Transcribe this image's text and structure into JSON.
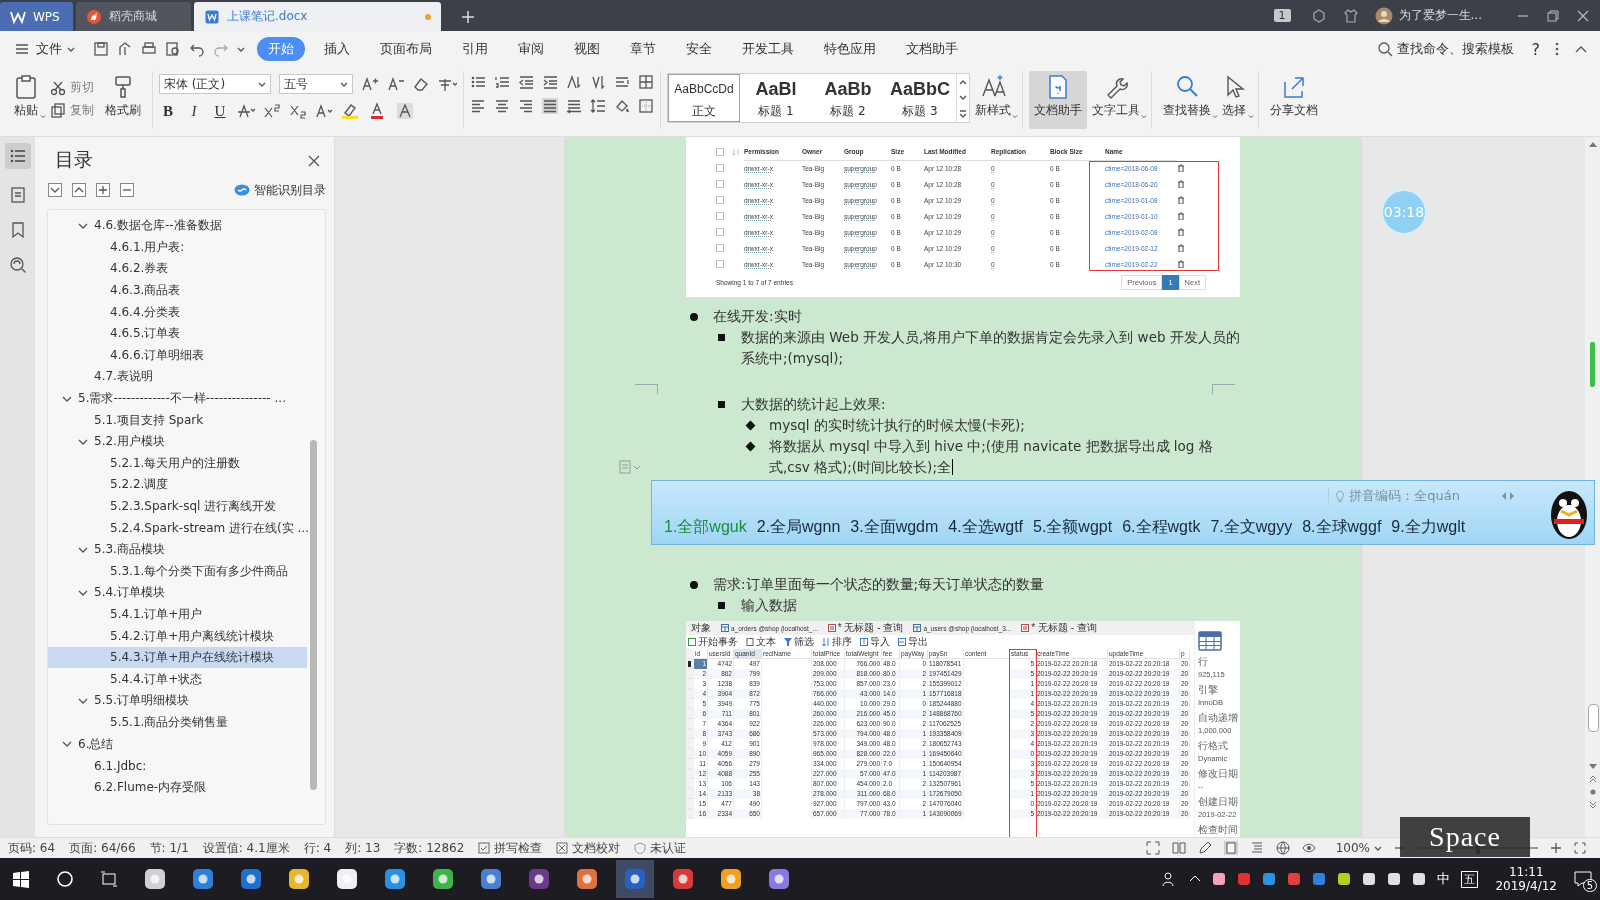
{
  "title_bar": {
    "tabs": [
      {
        "label": "WPS",
        "kind": "app",
        "selected": false,
        "modified": false
      },
      {
        "label": "稻壳商城",
        "kind": "store",
        "selected": false,
        "modified": false
      },
      {
        "label": "上课笔记.docx",
        "kind": "doc",
        "selected": true,
        "modified": true
      }
    ],
    "window_count": "1",
    "user": "为了爱梦一生..."
  },
  "menu_bar": {
    "file": "文件",
    "tabs": [
      {
        "label": "开始",
        "selected": true
      },
      {
        "label": "插入",
        "selected": false
      },
      {
        "label": "页面布局",
        "selected": false
      },
      {
        "label": "引用",
        "selected": false
      },
      {
        "label": "审阅",
        "selected": false
      },
      {
        "label": "视图",
        "selected": false
      },
      {
        "label": "章节",
        "selected": false
      },
      {
        "label": "安全",
        "selected": false
      },
      {
        "label": "开发工具",
        "selected": false
      },
      {
        "label": "特色应用",
        "selected": false
      },
      {
        "label": "文档助手",
        "selected": false
      }
    ],
    "search": "查找命令、搜索模板",
    "help": "?"
  },
  "ribbon": {
    "paste": "粘贴",
    "clipboard": [
      {
        "label": "剪切",
        "kind": "cut",
        "disabled": true
      },
      {
        "label": "复制",
        "kind": "copy",
        "disabled": true
      }
    ],
    "format_painter": "格式刷",
    "font": "宋体 (正文)",
    "size": "五号",
    "format_buttons": [
      {
        "label": "B",
        "kind": "bold"
      },
      {
        "label": "I",
        "kind": "italic"
      },
      {
        "label": "U",
        "kind": "underline"
      }
    ],
    "styles": [
      {
        "preview": "AaBbCcDd",
        "label": "正文",
        "kind": "body",
        "selected": true
      },
      {
        "preview": "AaBl",
        "label": "标题 1",
        "kind": "heading",
        "selected": false
      },
      {
        "preview": "AaBb",
        "label": "标题 2",
        "kind": "heading",
        "selected": false
      },
      {
        "preview": "AaBbC",
        "label": "标题 3",
        "kind": "heading",
        "selected": false
      }
    ],
    "new_style": "新样式",
    "tools": [
      {
        "label": "文档助手",
        "kind": "assistant",
        "selected": true,
        "dropdown": false
      },
      {
        "label": "文字工具",
        "kind": "wrench",
        "selected": false,
        "dropdown": true
      },
      {
        "label": "查找替换",
        "kind": "find",
        "selected": false,
        "dropdown": true
      },
      {
        "label": "选择",
        "kind": "pointer",
        "selected": false,
        "dropdown": true
      },
      {
        "label": "分享文档",
        "kind": "share",
        "selected": false,
        "dropdown": false
      }
    ]
  },
  "toc": {
    "title": "目录",
    "smart_button": "智能识别目录",
    "continued_items": [
      {
        "label": "4.6.数据仓库--准备数据",
        "selected": false,
        "expanded": true,
        "children": [
          {
            "label": "4.6.1.用户表:",
            "selected": false
          },
          {
            "label": "4.6.2.券表",
            "selected": false
          },
          {
            "label": "4.6.3.商品表",
            "selected": false
          },
          {
            "label": "4.6.4.分类表",
            "selected": false
          },
          {
            "label": "4.6.5.订单表",
            "selected": false
          },
          {
            "label": "4.6.6.订单明细表",
            "selected": false
          }
        ]
      },
      {
        "label": "4.7.表说明",
        "selected": false
      }
    ],
    "items": [
      {
        "label": "5.需求-------------不一样--------------- ...",
        "selected": false,
        "expanded": true,
        "children": [
          {
            "label": "5.1.项目支持 Spark",
            "selected": false
          },
          {
            "label": "5.2.用户模块",
            "selected": false,
            "expanded": true,
            "children": [
              {
                "label": "5.2.1.每天用户的注册数",
                "selected": false
              },
              {
                "label": "5.2.2.调度",
                "selected": false
              },
              {
                "label": "5.2.3.Spark-sql 进行离线开发",
                "selected": false
              },
              {
                "label": "5.2.4.Spark-stream 进行在线(实 ...",
                "selected": false
              }
            ]
          },
          {
            "label": "5.3.商品模块",
            "selected": false,
            "expanded": true,
            "children": [
              {
                "label": "5.3.1.每个分类下面有多少件商品",
                "selected": false
              }
            ]
          },
          {
            "label": "5.4.订单模块",
            "selected": false,
            "expanded": true,
            "children": [
              {
                "label": "5.4.1.订单+用户",
                "selected": false
              },
              {
                "label": "5.4.2.订单+用户离线统计模块",
                "selected": false
              },
              {
                "label": "5.4.3.订单+用户在线统计模块",
                "selected": true
              },
              {
                "label": "5.4.4.订单+状态",
                "selected": false
              }
            ]
          },
          {
            "label": "5.5.订单明细模块",
            "selected": false,
            "expanded": true,
            "children": [
              {
                "label": "5.5.1.商品分类销售量",
                "selected": false
              }
            ]
          }
        ]
      },
      {
        "label": "6.总结",
        "selected": false,
        "expanded": true,
        "children": [
          {
            "label": "6.1.Jdbc:",
            "selected": false
          },
          {
            "label": "6.2.Flume-内存受限",
            "selected": false
          }
        ]
      }
    ]
  },
  "document": {
    "blocks": [
      {
        "kind": "hdfs_table",
        "columns": [
          "Permission",
          "Owner",
          "Group",
          "Size",
          "Last Modified",
          "Replication",
          "Block Size",
          "Name"
        ],
        "rows": [
          [
            "drwxr-xr-x",
            "Tea-Big",
            "supergroup",
            "0 B",
            "Apr 12 10:28",
            "0",
            "0 B",
            "ctime=2018-06-08"
          ],
          [
            "drwxr-xr-x",
            "Tea-Big",
            "supergroup",
            "0 B",
            "Apr 12 10:28",
            "0",
            "0 B",
            "ctime=2018-06-20"
          ],
          [
            "drwxr-xr-x",
            "Tea-Big",
            "supergroup",
            "0 B",
            "Apr 12 10:29",
            "0",
            "0 B",
            "ctime=2019-01-08"
          ],
          [
            "drwxr-xr-x",
            "Tea-Big",
            "supergroup",
            "0 B",
            "Apr 12 10:29",
            "0",
            "0 B",
            "ctime=2019-01-10"
          ],
          [
            "drwxr-xr-x",
            "Tea-Big",
            "supergroup",
            "0 B",
            "Apr 12 10:29",
            "0",
            "0 B",
            "ctime=2019-02-08"
          ],
          [
            "drwxr-xr-x",
            "Tea-Big",
            "supergroup",
            "0 B",
            "Apr 12 10:29",
            "0",
            "0 B",
            "ctime=2019-02-12"
          ],
          [
            "drwxr-xr-x",
            "Tea-Big",
            "supergroup",
            "0 B",
            "Apr 12 10:30",
            "0",
            "0 B",
            "ctime=2019-02-22"
          ]
        ],
        "footer": "Showing 1 to 7 of 7 entries",
        "pages": [
          {
            "label": "Previous",
            "selected": false
          },
          {
            "label": "1",
            "selected": true
          },
          {
            "label": "Next",
            "selected": false
          }
        ]
      },
      {
        "kind": "list",
        "items": [
          {
            "kind": "item",
            "text": "在线开发:实时",
            "children": [
              {
                "kind": "item",
                "text": "数据的来源由 Web 开发人员,将用户下单的数据肯定会先录入到 web 开发人员的系统中;(mysql);"
              },
              {
                "kind": "page_break"
              },
              {
                "kind": "item",
                "text": "大数据的统计起上效果:",
                "children": [
                  {
                    "kind": "item",
                    "text": "mysql 的实时统计执行的时候太慢(卡死);"
                  },
                  {
                    "kind": "item",
                    "text": "将数据从 mysql 中导入到 hive 中;(使用 navicate 把数据导出成 log 格式,csv 格式);(时间比较长);全",
                    "cursor": true
                  }
                ]
              }
            ]
          }
        ]
      },
      {
        "kind": "list",
        "items": [
          {
            "kind": "item",
            "text": "需求:订单里面每一个状态的数量;每天订单状态的数量",
            "children": [
              {
                "kind": "item",
                "text": "输入数据"
              }
            ]
          }
        ]
      },
      {
        "kind": "db_table",
        "tabs": [
          {
            "label": "对象",
            "kind": "plain"
          },
          {
            "label": "a_orders @shop (localhost_...",
            "kind": "table"
          },
          {
            "label": "* 无标题 - 查询",
            "kind": "query"
          },
          {
            "label": "a_users @shop (localhost_3...",
            "kind": "table"
          },
          {
            "label": "* 无标题 - 查询",
            "kind": "query"
          }
        ],
        "toolbar": [
          {
            "label": "开始事务",
            "kind": "transaction"
          },
          {
            "label": "文本",
            "kind": "text"
          },
          {
            "label": "筛选",
            "kind": "filter"
          },
          {
            "label": "排序",
            "kind": "sort"
          },
          {
            "label": "导入",
            "kind": "import"
          },
          {
            "label": "导出",
            "kind": "export"
          }
        ],
        "columns": [
          {
            "label": "id",
            "kind": "num",
            "sorted": false
          },
          {
            "label": "usersId",
            "kind": "num",
            "sorted": false
          },
          {
            "label": "quanId",
            "kind": "num",
            "sorted": true
          },
          {
            "label": "reciName",
            "sorted": false
          },
          {
            "label": "totalPrice",
            "kind": "text",
            "sorted": false
          },
          {
            "label": "totalWeight",
            "kind": "num",
            "sorted": false
          },
          {
            "label": "fee",
            "kind": "text",
            "sorted": false
          },
          {
            "label": "payWay",
            "kind": "num",
            "sorted": false
          },
          {
            "label": "paySn",
            "kind": "text",
            "sorted": false
          },
          {
            "label": "content",
            "sorted": false
          },
          {
            "label": "status",
            "kind": "num",
            "sorted": false
          },
          {
            "label": "createTime",
            "kind": "text",
            "sorted": false
          },
          {
            "label": "updateTime",
            "kind": "text",
            "sorted": false
          },
          {
            "label": "p",
            "kind": "text",
            "sorted": false
          }
        ],
        "rows": [
          {
            "selected": true,
            "cells": [
              "1",
              "4742",
              "497",
              "",
              "208.000",
              "766.000",
              "48.0",
              "0",
              "118078541",
              "",
              "5",
              "2019-02-22 20:20:18",
              "2019-02-22 20:20:18",
              "20"
            ]
          },
          {
            "selected": false,
            "cells": [
              "2",
              "862",
              "799",
              "",
              "209.000",
              "818.000",
              "80.0",
              "2",
              "197451429",
              "",
              "5",
              "2019-02-22 20:20:19",
              "2019-02-22 20:20:19",
              "20"
            ]
          },
          {
            "selected": false,
            "cells": [
              "3",
              "1238",
              "839",
              "",
              "753.000",
              "857.000",
              "23.0",
              "2",
              "155399012",
              "",
              "1",
              "2019-02-22 20:20:19",
              "2019-02-22 20:20:19",
              "20"
            ]
          },
          {
            "selected": false,
            "cells": [
              "4",
              "3904",
              "872",
              "",
              "766.000",
              "43.000",
              "14.0",
              "1",
              "157716818",
              "",
              "1",
              "2019-02-22 20:20:19",
              "2019-02-22 20:20:19",
              "20"
            ]
          },
          {
            "selected": false,
            "cells": [
              "5",
              "3949",
              "775",
              "",
              "440.000",
              "10.000",
              "29.0",
              "0",
              "185244880",
              "",
              "4",
              "2019-02-22 20:20:19",
              "2019-02-22 20:20:19",
              "20"
            ]
          },
          {
            "selected": false,
            "cells": [
              "6",
              "711",
              "801",
              "",
              "260.000",
              "216.000",
              "45.0",
              "2",
              "148868760",
              "",
              "5",
              "2019-02-22 20:20:19",
              "2019-02-22 20:20:19",
              "20"
            ]
          },
          {
            "selected": false,
            "cells": [
              "7",
              "4364",
              "922",
              "",
              "226.000",
              "623.000",
              "90.0",
              "2",
              "117062525",
              "",
              "2",
              "2019-02-22 20:20:19",
              "2019-02-22 20:20:19",
              "20"
            ]
          },
          {
            "selected": false,
            "cells": [
              "8",
              "3743",
              "686",
              "",
              "573.000",
              "794.000",
              "48.0",
              "1",
              "193358409",
              "",
              "3",
              "2019-02-22 20:20:19",
              "2019-02-22 20:20:19",
              "20"
            ]
          },
          {
            "selected": false,
            "cells": [
              "9",
              "412",
              "901",
              "",
              "978.000",
              "349.000",
              "48.0",
              "2",
              "180652743",
              "",
              "4",
              "2019-02-22 20:20:19",
              "2019-02-22 20:20:19",
              "20"
            ]
          },
          {
            "selected": false,
            "cells": [
              "10",
              "4059",
              "890",
              "",
              "965.000",
              "828.000",
              "22.0",
              "1",
              "169450640",
              "",
              "0",
              "2019-02-22 20:20:19",
              "2019-02-22 20:20:19",
              "20"
            ]
          },
          {
            "selected": false,
            "cells": [
              "11",
              "4056",
              "279",
              "",
              "334.000",
              "279.000",
              "7.0",
              "1",
              "150640954",
              "",
              "3",
              "2019-02-22 20:20:19",
              "2019-02-22 20:20:19",
              "20"
            ]
          },
          {
            "selected": false,
            "cells": [
              "12",
              "4088",
              "255",
              "",
              "227.000",
              "57.000",
              "47.0",
              "1",
              "114203987",
              "",
              "3",
              "2019-02-22 20:20:19",
              "2019-02-22 20:20:19",
              "20"
            ]
          },
          {
            "selected": false,
            "cells": [
              "13",
              "106",
              "143",
              "",
              "807.000",
              "454.000",
              "2.0",
              "2",
              "132507961",
              "",
              "5",
              "2019-02-22 20:20:19",
              "2019-02-22 20:20:19",
              "20"
            ]
          },
          {
            "selected": false,
            "cells": [
              "14",
              "2133",
              "38",
              "",
              "278.000",
              "311.000",
              "68.0",
              "1",
              "172679050",
              "",
              "1",
              "2019-02-22 20:20:19",
              "2019-02-22 20:20:19",
              "20"
            ]
          },
          {
            "selected": false,
            "cells": [
              "15",
              "477",
              "490",
              "",
              "927.000",
              "797.000",
              "43.0",
              "2",
              "147076040",
              "",
              "0",
              "2019-02-22 20:20:19",
              "2019-02-22 20:20:19",
              "20"
            ]
          },
          {
            "selected": false,
            "cells": [
              "16",
              "2334",
              "650",
              "",
              "657.000",
              "77.000",
              "78.0",
              "1",
              "143090069",
              "",
              "5",
              "2019-02-22 20:20:19",
              "2019-02-22 20:20:19",
              "20"
            ]
          }
        ],
        "info": [
          {
            "label": "行",
            "value": "925,115"
          },
          {
            "label": "引擎",
            "value": "InnoDB"
          },
          {
            "label": "自动递增",
            "value": "1,000,000"
          },
          {
            "label": "行格式",
            "value": "Dynamic"
          },
          {
            "label": "修改日期",
            "value": "--"
          },
          {
            "label": "创建日期",
            "value": "2019-02-22"
          },
          {
            "label": "检查时间"
          }
        ]
      }
    ]
  },
  "ime": {
    "hint": "拼音编码：全quán",
    "candidates": [
      {
        "text": "1.全部wguk",
        "selected": true
      },
      {
        "text": "2.全局wgnn",
        "selected": false
      },
      {
        "text": "3.全面wgdm",
        "selected": false
      },
      {
        "text": "4.全选wgtf",
        "selected": false
      },
      {
        "text": "5.全额wgpt",
        "selected": false
      },
      {
        "text": "6.全程wgtk",
        "selected": false
      },
      {
        "text": "7.全文wgyy",
        "selected": false
      },
      {
        "text": "8.全球wggf",
        "selected": false
      },
      {
        "text": "9.全力wglt",
        "selected": false
      }
    ]
  },
  "timer": "03:18",
  "key_overlay": "Space",
  "status_bar": {
    "fields": [
      "页码: 64",
      "页面: 64/66",
      "节: 1/1",
      "设置值: 4.1厘米",
      "行: 4",
      "列: 13",
      "字数: 12862"
    ],
    "toggles": [
      {
        "label": "拼写检查",
        "kind": "spell"
      },
      {
        "label": "文档校对",
        "kind": "proof"
      },
      {
        "label": "未认证",
        "kind": "cert"
      }
    ],
    "zoom": "100%",
    "zoom_slider": {
      "level": 0.5
    }
  },
  "taskbar": {
    "ime_mode": "中",
    "ime_name": "五",
    "time": "11:11",
    "date": "2019/4/12",
    "notifications": "5"
  }
}
